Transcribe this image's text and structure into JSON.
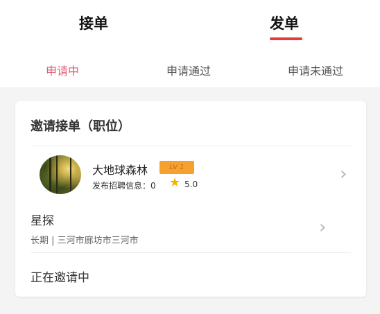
{
  "tabs": {
    "receive": "接单",
    "send": "发单"
  },
  "subtabs": {
    "applying": "申请中",
    "approved": "申请通过",
    "rejected": "申请未通过"
  },
  "card": {
    "title": "邀请接单（职位）",
    "user": {
      "name": "大地球森林",
      "level": "LV 1",
      "info": "发布招聘信息：0",
      "rating": "5.0"
    },
    "job": {
      "title": "星探",
      "meta": "长期 | 三河市廊坊市三河市"
    },
    "status": "正在邀请中"
  },
  "colors": {
    "accent_red": "#e73b3b",
    "subtab_active": "#e45d7a",
    "badge_orange": "#f5a12f",
    "star": "#f5b400"
  },
  "icons": {
    "star": "star-icon",
    "chevron": "chevron-right-icon"
  }
}
